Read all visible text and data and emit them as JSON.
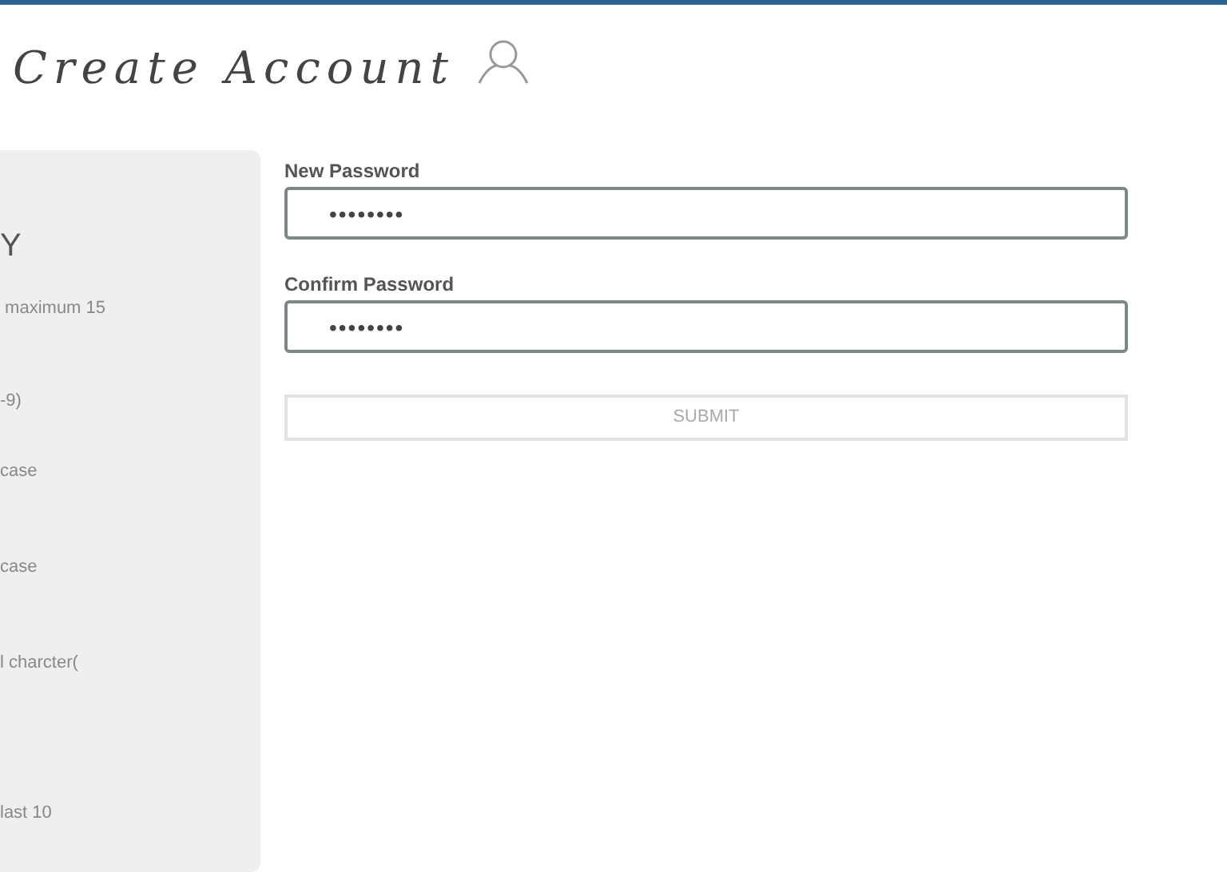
{
  "title": "Create Account",
  "rules_panel": {
    "heading": "Y",
    "items": [
      " maximum 15",
      "-9)",
      "case",
      "case",
      "l charcter(",
      "last 10"
    ]
  },
  "fields": [
    {
      "label": "New Password",
      "value": "••••••••"
    },
    {
      "label": "Confirm Password",
      "value": "••••••••"
    }
  ],
  "submit": {
    "label": "SUBMIT",
    "disabled": true
  }
}
